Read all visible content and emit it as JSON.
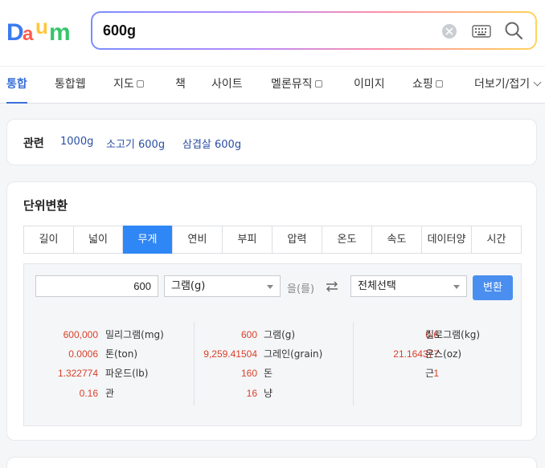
{
  "brand": {
    "logo_colors": [
      "#3b7bf0",
      "#ff5a4c",
      "#ffc63b",
      "#36c66a",
      "#ff5a4c"
    ]
  },
  "search": {
    "query": "600g"
  },
  "tabs": [
    {
      "label": "통합",
      "active": true,
      "external": false
    },
    {
      "label": "통합웹",
      "external": false
    },
    {
      "label": "지도",
      "external": true
    },
    {
      "label": "책",
      "external": false
    },
    {
      "label": "사이트",
      "external": false
    },
    {
      "label": "멜론뮤직",
      "external": true
    },
    {
      "label": "이미지",
      "external": false
    },
    {
      "label": "쇼핑",
      "external": true
    },
    {
      "label": "더보기/접기",
      "external": false
    }
  ],
  "related": {
    "title": "관련",
    "links": [
      "1000g",
      "소고기 600g",
      "삼겹살 600g"
    ]
  },
  "converter": {
    "title": "단위변환",
    "unit_tabs": [
      "길이",
      "넓이",
      "무게",
      "연비",
      "부피",
      "압력",
      "온도",
      "속도",
      "데이터양",
      "시간"
    ],
    "active_tab": "무게",
    "input_value": "600",
    "from_unit": "그램(g)",
    "particle": "을(를)",
    "to_unit": "전체선택",
    "convert_label": "변환",
    "results": [
      [
        {
          "value": "600,000",
          "unit": "밀리그램(mg)"
        },
        {
          "value": "0.0006",
          "unit": "톤(ton)"
        },
        {
          "value": "1.322774",
          "unit": "파운드(lb)"
        },
        {
          "value": "0.16",
          "unit": "관"
        }
      ],
      [
        {
          "value": "600",
          "unit": "그램(g)"
        },
        {
          "value": "9,259.41504",
          "unit": "그레인(grain)"
        },
        {
          "value": "160",
          "unit": "돈"
        },
        {
          "value": "16",
          "unit": "냥"
        }
      ],
      [
        {
          "value": "0.6",
          "unit": "킬로그램(kg)"
        },
        {
          "value": "21.164377",
          "unit": "온스(oz)"
        },
        {
          "value": "1",
          "unit": "근"
        }
      ]
    ],
    "accent_color": "#2f86f5",
    "value_color": "#d9402a"
  }
}
